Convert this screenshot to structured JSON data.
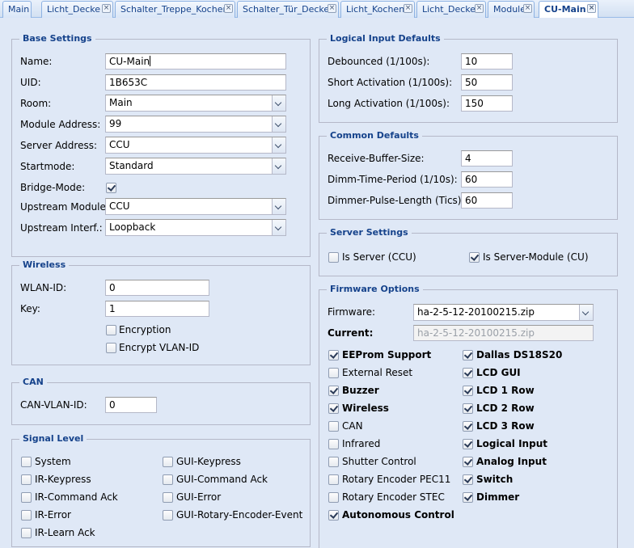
{
  "tabs": [
    {
      "label": "Main",
      "closable": false,
      "active": false
    },
    {
      "label": "Licht_Decke",
      "closable": true,
      "active": false
    },
    {
      "label": "Schalter_Treppe_Kochen",
      "closable": true,
      "active": false
    },
    {
      "label": "Schalter_Tür_Decke",
      "closable": true,
      "active": false
    },
    {
      "label": "Licht_Kochen",
      "closable": true,
      "active": false
    },
    {
      "label": "Licht_Decke",
      "closable": true,
      "active": false
    },
    {
      "label": "Module",
      "closable": true,
      "active": false
    },
    {
      "label": "CU-Main",
      "closable": true,
      "active": true
    }
  ],
  "base_settings": {
    "legend": "Base Settings",
    "name_label": "Name:",
    "name_value": "CU-Main",
    "uid_label": "UID:",
    "uid_value": "1B653C",
    "room_label": "Room:",
    "room_value": "Main",
    "module_address_label": "Module Address:",
    "module_address_value": "99",
    "server_address_label": "Server Address:",
    "server_address_value": "CCU",
    "startmode_label": "Startmode:",
    "startmode_value": "Standard",
    "bridge_mode_label": "Bridge-Mode:",
    "bridge_mode_checked": true,
    "upstream_module_label": "Upstream Module:",
    "upstream_module_value": "CCU",
    "upstream_interf_label": "Upstream Interf.:",
    "upstream_interf_value": "Loopback"
  },
  "wireless": {
    "legend": "Wireless",
    "wlan_id_label": "WLAN-ID:",
    "wlan_id_value": "0",
    "key_label": "Key:",
    "key_value": "1",
    "encryption_label": "Encryption",
    "encryption_checked": false,
    "encrypt_vlan_label": "Encrypt VLAN-ID",
    "encrypt_vlan_checked": false
  },
  "can": {
    "legend": "CAN",
    "can_vlan_label": "CAN-VLAN-ID:",
    "can_vlan_value": "0"
  },
  "signal_level": {
    "legend": "Signal Level",
    "left": [
      {
        "label": "System",
        "checked": false
      },
      {
        "label": "IR-Keypress",
        "checked": false
      },
      {
        "label": "IR-Command Ack",
        "checked": false
      },
      {
        "label": "IR-Error",
        "checked": false
      },
      {
        "label": "IR-Learn Ack",
        "checked": false
      }
    ],
    "right": [
      {
        "label": "GUI-Keypress",
        "checked": false
      },
      {
        "label": "GUI-Command Ack",
        "checked": false
      },
      {
        "label": "GUI-Error",
        "checked": false
      },
      {
        "label": "GUI-Rotary-Encoder-Event",
        "checked": false
      }
    ]
  },
  "logical_input": {
    "legend": "Logical Input Defaults",
    "debounced_label": "Debounced (1/100s):",
    "debounced_value": "10",
    "short_label": "Short Activation (1/100s):",
    "short_value": "50",
    "long_label": "Long Activation (1/100s):",
    "long_value": "150"
  },
  "common": {
    "legend": "Common Defaults",
    "rbs_label": "Receive-Buffer-Size:",
    "rbs_value": "4",
    "dimm_time_label": "Dimm-Time-Period (1/10s):",
    "dimm_time_value": "60",
    "dimmer_pulse_label": "Dimmer-Pulse-Length (Tics):",
    "dimmer_pulse_value": "60"
  },
  "server": {
    "legend": "Server Settings",
    "is_server_label": "Is Server (CCU)",
    "is_server_checked": false,
    "is_server_module_label": "Is Server-Module (CU)",
    "is_server_module_checked": true
  },
  "firmware": {
    "legend": "Firmware Options",
    "firmware_label": "Firmware:",
    "firmware_value": "ha-2-5-12-20100215.zip",
    "current_label": "Current:",
    "current_value": "ha-2-5-12-20100215.zip",
    "left": [
      {
        "label": "EEProm Support",
        "checked": true
      },
      {
        "label": "External Reset",
        "checked": false
      },
      {
        "label": "Buzzer",
        "checked": true
      },
      {
        "label": "Wireless",
        "checked": true
      },
      {
        "label": "CAN",
        "checked": false
      },
      {
        "label": "Infrared",
        "checked": false
      },
      {
        "label": "Shutter Control",
        "checked": false
      },
      {
        "label": "Rotary Encoder PEC11",
        "checked": false
      },
      {
        "label": "Rotary Encoder STEC",
        "checked": false
      },
      {
        "label": "Autonomous Control",
        "checked": true
      }
    ],
    "right": [
      {
        "label": "Dallas DS18S20",
        "checked": true
      },
      {
        "label": "LCD GUI",
        "checked": true
      },
      {
        "label": "LCD 1 Row",
        "checked": true
      },
      {
        "label": "LCD 2 Row",
        "checked": true
      },
      {
        "label": "LCD 3 Row",
        "checked": true
      },
      {
        "label": "Logical Input",
        "checked": true
      },
      {
        "label": "Analog Input",
        "checked": true
      },
      {
        "label": "Switch",
        "checked": true
      },
      {
        "label": "Dimmer",
        "checked": true
      }
    ]
  }
}
